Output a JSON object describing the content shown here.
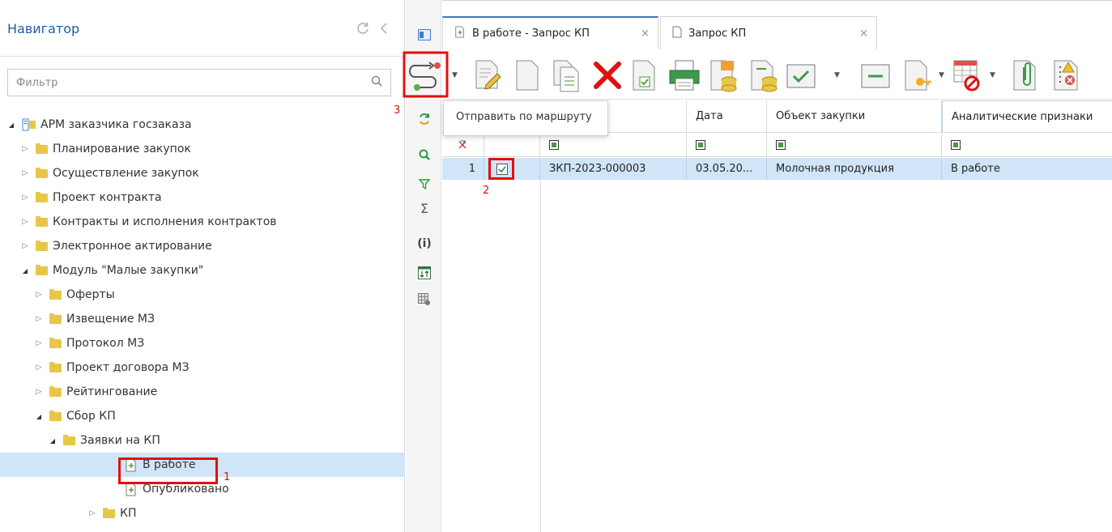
{
  "navigator": {
    "title": "Навигатор",
    "filter_placeholder": "Фильтр",
    "tree": [
      {
        "label": "АРМ заказчика госзаказа",
        "level": 0,
        "state": "open",
        "icon": "workstation-icon"
      },
      {
        "label": "Планирование закупок",
        "level": 1,
        "state": "closed",
        "icon": "folder-icon"
      },
      {
        "label": "Осуществление закупок",
        "level": 1,
        "state": "closed",
        "icon": "folder-icon"
      },
      {
        "label": "Проект контракта",
        "level": 1,
        "state": "closed",
        "icon": "folder-icon"
      },
      {
        "label": "Контракты и исполнения контрактов",
        "level": 1,
        "state": "closed",
        "icon": "folder-icon"
      },
      {
        "label": "Электронное актирование",
        "level": 1,
        "state": "closed",
        "icon": "folder-icon"
      },
      {
        "label": "Модуль \"Малые закупки\"",
        "level": 1,
        "state": "open",
        "icon": "folder-icon"
      },
      {
        "label": "Оферты",
        "level": 2,
        "state": "closed",
        "icon": "folder-icon"
      },
      {
        "label": "Извещение МЗ",
        "level": 2,
        "state": "closed",
        "icon": "folder-icon"
      },
      {
        "label": "Протокол МЗ",
        "level": 2,
        "state": "closed",
        "icon": "folder-icon"
      },
      {
        "label": "Проект договора МЗ",
        "level": 2,
        "state": "closed",
        "icon": "folder-icon"
      },
      {
        "label": "Рейтингование",
        "level": 2,
        "state": "closed",
        "icon": "folder-icon"
      },
      {
        "label": "Сбор КП",
        "level": 2,
        "state": "open",
        "icon": "folder-icon"
      },
      {
        "label": "Заявки на КП",
        "level": 3,
        "state": "open",
        "icon": "folder-icon"
      },
      {
        "label": "В работе",
        "level": 4,
        "state": "leaf",
        "icon": "document-icon",
        "selected": true
      },
      {
        "label": "Опубликовано",
        "level": 4,
        "state": "leaf",
        "icon": "document-icon"
      },
      {
        "label": "КП",
        "level": 3,
        "state": "closed",
        "icon": "folder-icon"
      }
    ]
  },
  "tabs": [
    {
      "label": "В работе - Запрос КП",
      "active": true,
      "close": "×"
    },
    {
      "label": "Запрос КП",
      "active": false,
      "close": "×"
    }
  ],
  "tooltip": "Отправить по маршруту",
  "grid": {
    "columns": [
      "",
      "",
      "",
      "Дата",
      "Объект закупки",
      "Аналитические признаки"
    ],
    "rows": [
      {
        "num": "1",
        "checked": true,
        "number": "ЗКП-2023-000003",
        "date": "03.05.20...",
        "object": "Молочная продукция",
        "analytic": "В работе"
      }
    ]
  },
  "annotations": {
    "one": "1",
    "two": "2",
    "three": "3"
  },
  "colors": {
    "accent": "#1a5fa8",
    "selection": "#d0e5f7",
    "highlight": "#e01010"
  }
}
